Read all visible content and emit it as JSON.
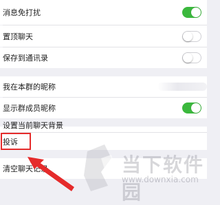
{
  "settings": {
    "mute": {
      "label": "消息免打扰",
      "state": "on"
    },
    "pin": {
      "label": "置顶聊天",
      "state": "off"
    },
    "save_contacts": {
      "label": "保存到通讯录",
      "state": "off"
    },
    "my_nickname": {
      "label": "我在本群的昵称"
    },
    "show_member_nickname": {
      "label": "显示群成员昵称",
      "state": "on"
    },
    "set_background": {
      "label": "设置当前聊天背景"
    },
    "complain": {
      "label": "投诉"
    },
    "clear_history": {
      "label": "清空聊天记录"
    }
  },
  "watermark": {
    "brand": "当下软件园",
    "url": "www.downxia.com"
  },
  "colors": {
    "toggle_on": "#3bb83d",
    "highlight": "#e52b2b",
    "arrow": "#e52b2b"
  }
}
